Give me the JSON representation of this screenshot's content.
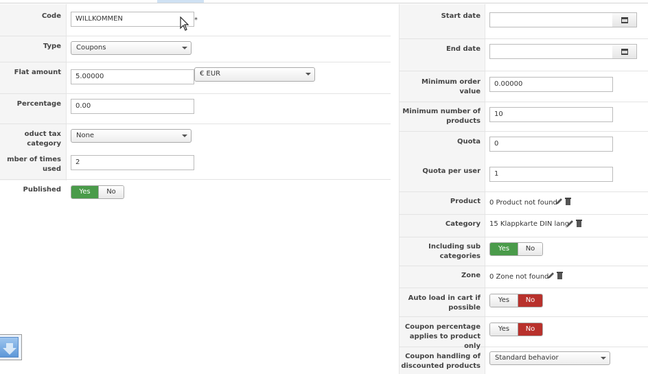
{
  "left": {
    "code": {
      "label": "Code",
      "value": "WILLKOMMEN",
      "required": "*"
    },
    "type": {
      "label": "Type",
      "value": "Coupons"
    },
    "flat_amount": {
      "label": "Flat amount",
      "value": "5.00000",
      "currency": "€ EUR"
    },
    "percentage": {
      "label": "Percentage",
      "value": "0.00"
    },
    "tax_category": {
      "label": "oduct tax category",
      "value": "None"
    },
    "times_used": {
      "label": "mber of times used",
      "value": "2"
    },
    "published": {
      "label": "Published",
      "yes": "Yes",
      "no": "No",
      "active": "yes"
    }
  },
  "right": {
    "start_date": {
      "label": "Start date",
      "value": ""
    },
    "end_date": {
      "label": "End date",
      "value": ""
    },
    "min_order": {
      "label": "Minimum order value",
      "value": "0.00000"
    },
    "min_products": {
      "label_line1": "Minimum number of",
      "label_line2": "products",
      "value": "10"
    },
    "quota": {
      "label": "Quota",
      "value": "0"
    },
    "quota_user": {
      "label": "Quota per user",
      "value": "1"
    },
    "product": {
      "label": "Product",
      "value": "0 Product not found"
    },
    "category": {
      "label": "Category",
      "value": "15 Klappkarte DIN lang"
    },
    "including_sub": {
      "label_line1": "Including sub",
      "label_line2": "categories",
      "yes": "Yes",
      "no": "No",
      "active": "yes"
    },
    "zone": {
      "label": "Zone",
      "value": "0 Zone not found"
    },
    "auto_load": {
      "label_line1": "Auto load in cart if",
      "label_line2": "possible",
      "yes": "Yes",
      "no": "No",
      "active": "no"
    },
    "coupon_pct": {
      "label_line1": "Coupon percentage",
      "label_line2": "applies to product only",
      "yes": "Yes",
      "no": "No",
      "active": "no"
    },
    "coupon_handling": {
      "label_line1": "Coupon handling of",
      "label_line2": "discounted products",
      "value": "Standard behavior"
    }
  },
  "colors": {
    "green": "#4a9b4a",
    "red": "#b8312c"
  },
  "icons": [
    "calendar-icon",
    "pencil-icon",
    "trash-icon",
    "mouse-cursor-icon",
    "download-arrow-icon"
  ]
}
